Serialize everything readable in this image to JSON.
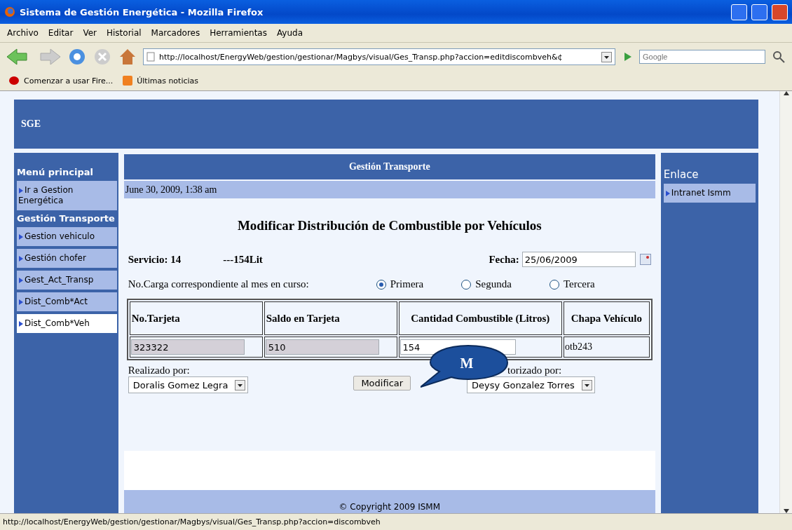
{
  "window": {
    "title": "Sistema de Gestión Energética - Mozilla Firefox"
  },
  "menu": [
    "Archivo",
    "Editar",
    "Ver",
    "Historial",
    "Marcadores",
    "Herramientas",
    "Ayuda"
  ],
  "address": {
    "value": "http://localhost/EnergyWeb/gestion/gestionar/Magbys/visual/Ges_Transp.php?accion=editdiscombveh&¢"
  },
  "search": {
    "placeholder": "Google"
  },
  "bookmarks": [
    "Comenzar a usar Fire...",
    "Últimas noticias"
  ],
  "header": {
    "title": "SGE"
  },
  "sidebar": {
    "sections": [
      {
        "title": "Menú principal",
        "items": [
          {
            "label": "Ir a Gestion Energética",
            "selected": false
          }
        ]
      },
      {
        "title": "Gestión Transporte",
        "items": [
          {
            "label": "Gestion vehiculo",
            "selected": false
          },
          {
            "label": "Gestión chofer",
            "selected": false
          },
          {
            "label": "Gest_Act_Transp",
            "selected": false
          },
          {
            "label": "Dist_Comb*Act",
            "selected": false
          },
          {
            "label": "Dist_Comb*Veh",
            "selected": true
          }
        ]
      }
    ]
  },
  "main": {
    "title": "Gestión Transporte",
    "date": "June 30, 2009, 1:38 am",
    "heading": "Modificar Distribución de Combustible por Vehículos",
    "servicio": "Servicio: 14",
    "litros": "---154Lit",
    "fecha_label": "Fecha:",
    "fecha": "25/06/2009",
    "carga_label": "No.Carga correspondiente al mes en curso:",
    "radios": [
      {
        "label": "Primera",
        "selected": true
      },
      {
        "label": "Segunda",
        "selected": false
      },
      {
        "label": "Tercera",
        "selected": false
      }
    ],
    "table": {
      "columns": [
        "No.Tarjeta",
        "Saldo en Tarjeta",
        "Cantidad Combustible (Litros)",
        "Chapa Vehículo"
      ],
      "row": [
        {
          "kind": "readonly",
          "value": "323322"
        },
        {
          "kind": "readonly",
          "value": "510"
        },
        {
          "kind": "input",
          "value": "154"
        },
        {
          "kind": "text",
          "value": "otb243"
        }
      ]
    },
    "realizado_label": "Realizado por:",
    "realizado": "Doralis Gomez Legra",
    "button": "Modificar",
    "autorizado_label": "torizado por:",
    "autorizado": "Deysy Gonzalez Torres",
    "callout": "M",
    "footer": "© Copyright 2009 ISMM"
  },
  "right": {
    "title": "Enlace",
    "items": [
      "Intranet Ismm"
    ]
  },
  "status_bar": "http://localhost/EnergyWeb/gestion/gestionar/Magbys/visual/Ges_Transp.php?accion=discombveh"
}
